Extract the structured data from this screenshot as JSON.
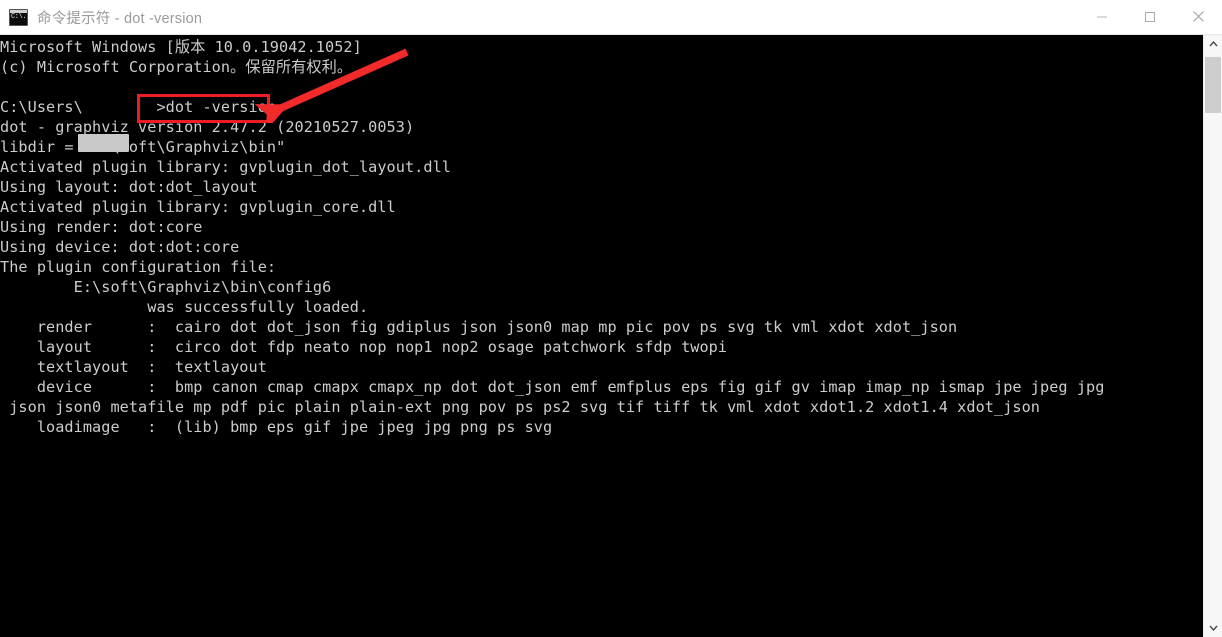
{
  "window": {
    "title": "命令提示符 - dot  -version",
    "icon": "cmd-prompt-icon",
    "background_color": "#000000",
    "titlebar_color": "#ffffff",
    "text_color": "#cccccc",
    "controls": {
      "minimize_label": "Minimize",
      "maximize_label": "Maximize",
      "close_label": "Close"
    }
  },
  "console": {
    "lines": [
      "Microsoft Windows [版本 10.0.19042.1052]",
      "(c) Microsoft Corporation。保留所有权利。",
      "",
      "C:\\Users\\        >dot -version",
      "dot - graphviz version 2.47.2 (20210527.0053)",
      "libdir = \"E:\\soft\\Graphviz\\bin\"",
      "Activated plugin library: gvplugin_dot_layout.dll",
      "Using layout: dot:dot_layout",
      "Activated plugin library: gvplugin_core.dll",
      "Using render: dot:core",
      "Using device: dot:dot:core",
      "The plugin configuration file:",
      "        E:\\soft\\Graphviz\\bin\\config6",
      "                was successfully loaded.",
      "    render      :  cairo dot dot_json fig gdiplus json json0 map mp pic pov ps svg tk vml xdot xdot_json",
      "    layout      :  circo dot fdp neato nop nop1 nop2 osage patchwork sfdp twopi",
      "    textlayout  :  textlayout",
      "    device      :  bmp canon cmap cmapx cmapx_np dot dot_json emf emfplus eps fig gif gv imap imap_np ismap jpe jpeg jpg",
      " json json0 metafile mp pdf pic plain plain-ext png pov ps ps2 svg tif tiff tk vml xdot xdot1.2 xdot1.4 xdot_json",
      "    loadimage   :  (lib) bmp eps gif jpe jpeg jpg png ps svg"
    ],
    "prompt_command": "dot -version",
    "redacted_username": true
  },
  "annotations": {
    "highlight_color": "#ee1c25",
    "highlight_target": "dot -version",
    "arrow_color": "#ee1c25",
    "arrow_direction": "down-left"
  },
  "scrollbar": {
    "up_arrow": "chevron-up-icon",
    "down_arrow": "chevron-down-icon",
    "thumb_position_percent": 4
  }
}
